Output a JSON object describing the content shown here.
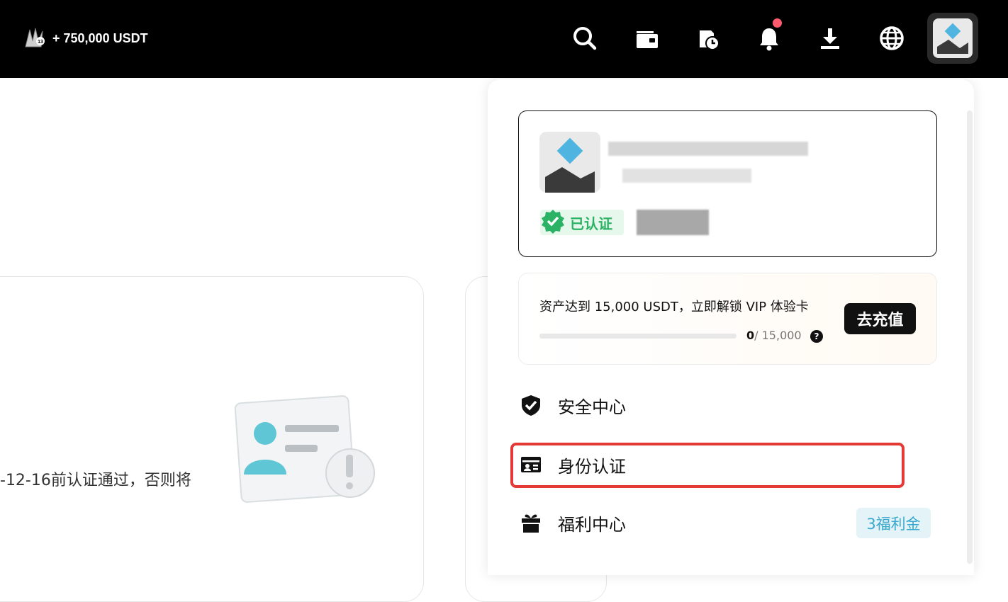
{
  "header": {
    "promo_text": "+ 750,000 USDT",
    "icons": [
      "search-icon",
      "wallet-icon",
      "order-history-icon",
      "bell-icon",
      "download-icon",
      "globe-icon"
    ],
    "notification_dot_color": "#ff5a6e"
  },
  "background": {
    "partial_text": "-12-16前认证通过，否则将"
  },
  "profile": {
    "verified_label": "已认证",
    "verified_color": "#2bb264"
  },
  "vip": {
    "title": "资产达到 15,000 USDT，立即解锁 VIP 体验卡",
    "current": "0",
    "target": "/ 15,000",
    "progress_fraction": 0,
    "help_symbol": "?",
    "recharge_label": "去充值"
  },
  "menu": {
    "items": [
      {
        "label": "安全中心",
        "icon": "shield-check-icon"
      },
      {
        "label": "身份认证",
        "icon": "id-card-icon"
      },
      {
        "label": "福利中心",
        "icon": "gift-icon"
      }
    ],
    "welfare_badge": "3福利金",
    "highlight_color": "#e53935"
  }
}
